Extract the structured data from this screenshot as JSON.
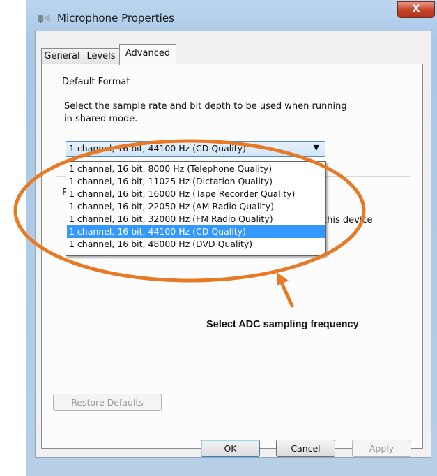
{
  "window": {
    "title": "Microphone Properties",
    "close_label": "X"
  },
  "tabs": [
    {
      "label": "General",
      "active": false
    },
    {
      "label": "Levels",
      "active": false
    },
    {
      "label": "Advanced",
      "active": true
    }
  ],
  "default_format": {
    "group_label": "Default Format",
    "description_line1": "Select the sample rate and bit depth to be used when running",
    "description_line2": "in shared mode.",
    "selected_value": "1 channel, 16 bit, 44100 Hz (CD Quality)",
    "options": [
      "1 channel, 16 bit, 8000 Hz (Telephone Quality)",
      "1 channel, 16 bit, 11025 Hz (Dictation Quality)",
      "1 channel, 16 bit, 16000 Hz (Tape Recorder Quality)",
      "1 channel, 16 bit, 22050 Hz (AM Radio Quality)",
      "1 channel, 16 bit, 32000 Hz (FM Radio Quality)",
      "1 channel, 16 bit, 44100 Hz (CD Quality)",
      "1 channel, 16 bit, 48000 Hz (DVD Quality)"
    ],
    "selected_index": 5
  },
  "exclusive_mode": {
    "group_label_fragment": "E",
    "description_fragment": "this device"
  },
  "buttons": {
    "restore_defaults": "Restore Defaults",
    "ok": "OK",
    "cancel": "Cancel",
    "apply": "Apply"
  },
  "annotation": {
    "caption": "Select ADC sampling frequency",
    "color": "#e87a26"
  }
}
